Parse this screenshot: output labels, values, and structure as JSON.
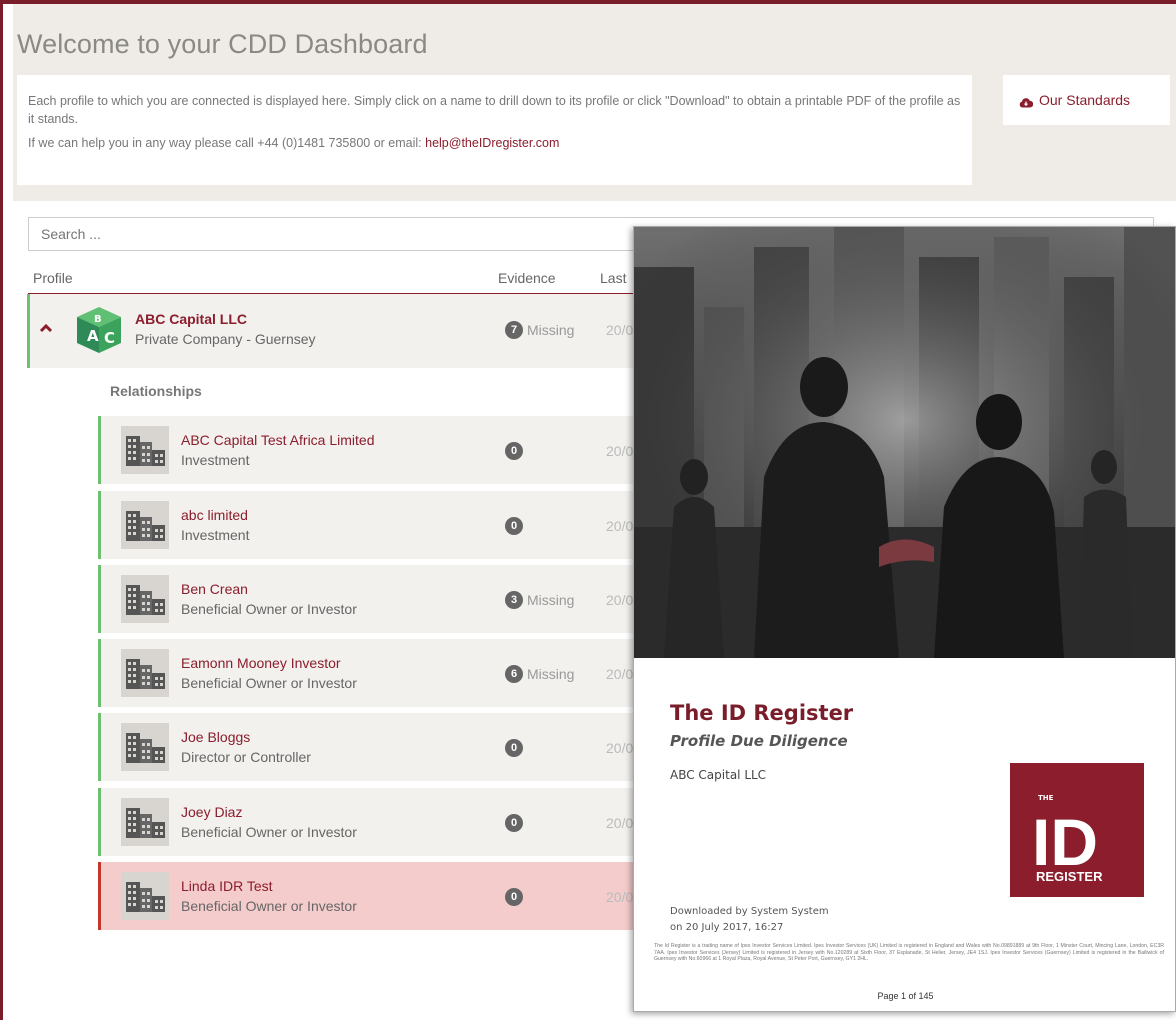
{
  "page": {
    "title": "Welcome to your CDD Dashboard",
    "intro_text_1": "Each profile to which you are connected is displayed here. Simply click on a name to drill down to its profile or click \"Download\" to obtain a printable PDF of the profile as it stands.",
    "intro_text_2": "If we can help you in any way please call +44 (0)1481 735800 or email: ",
    "help_email": "help@theIDregister.com",
    "standards_button": "Our Standards"
  },
  "search": {
    "placeholder": "Search ..."
  },
  "table": {
    "headers": {
      "profile": "Profile",
      "evidence": "Evidence",
      "last": "Last"
    },
    "main_profile": {
      "name": "ABC Capital LLC",
      "type": "Private Company - Guernsey",
      "evidence_count": "7",
      "evidence_label": "Missing",
      "date": "20/0"
    },
    "relationships_label": "Relationships",
    "relationships": [
      {
        "name": "ABC Capital Test Africa Limited",
        "type": "Investment",
        "count": "0",
        "missing": "",
        "date": "20/0"
      },
      {
        "name": "abc limited",
        "type": "Investment",
        "count": "0",
        "missing": "",
        "date": "20/0"
      },
      {
        "name": "Ben Crean",
        "type": "Beneficial Owner or Investor",
        "count": "3",
        "missing": "Missing",
        "date": "20/0"
      },
      {
        "name": "Eamonn Mooney Investor",
        "type": "Beneficial Owner or Investor",
        "count": "6",
        "missing": "Missing",
        "date": "20/0"
      },
      {
        "name": "Joe Bloggs",
        "type": "Director or Controller",
        "count": "0",
        "missing": "",
        "date": "20/0"
      },
      {
        "name": "Joey Diaz",
        "type": "Beneficial Owner or Investor",
        "count": "0",
        "missing": "",
        "date": "20/0"
      },
      {
        "name": "Linda IDR Test",
        "type": "Beneficial Owner or Investor",
        "count": "0",
        "missing": "",
        "date": "20/0"
      }
    ]
  },
  "pdf": {
    "title": "The ID Register",
    "subtitle": "Profile Due Diligence",
    "company": "ABC Capital LLC",
    "downloaded_by": "Downloaded by System System",
    "downloaded_on": "on 20 July 2017, 16:27",
    "logo_top": "THE",
    "logo_main": "ID",
    "logo_bottom": "REGISTER",
    "footer": "The Id Register is a trading name of Ipes Investor Services Limited. Ipes Investor Services (UK) Limited is registered in England and Wales with No.09891889 at 9th Floor, 1 Minster Court, Mincing Lane, London, EC3R 7AA. Ipes Investor Services (Jersey) Limited is registered in Jersey with No.120289 at Sixth Floor, 37 Esplanade, St Helier, Jersey, JE4 1SJ. Ipes Investor Services (Guernsey) Limited is registered in the Bailiwick of Guernsey with No.60966 at 1 Royal Plaza, Royal Avenue, St Peter Port, Guernsey, GY1 2HL.",
    "page_label": "Page 1 of 145"
  },
  "colors": {
    "brand": "#8b1d2c",
    "active_border": "#6fbf73",
    "highlight_row": "#f4cccc"
  }
}
